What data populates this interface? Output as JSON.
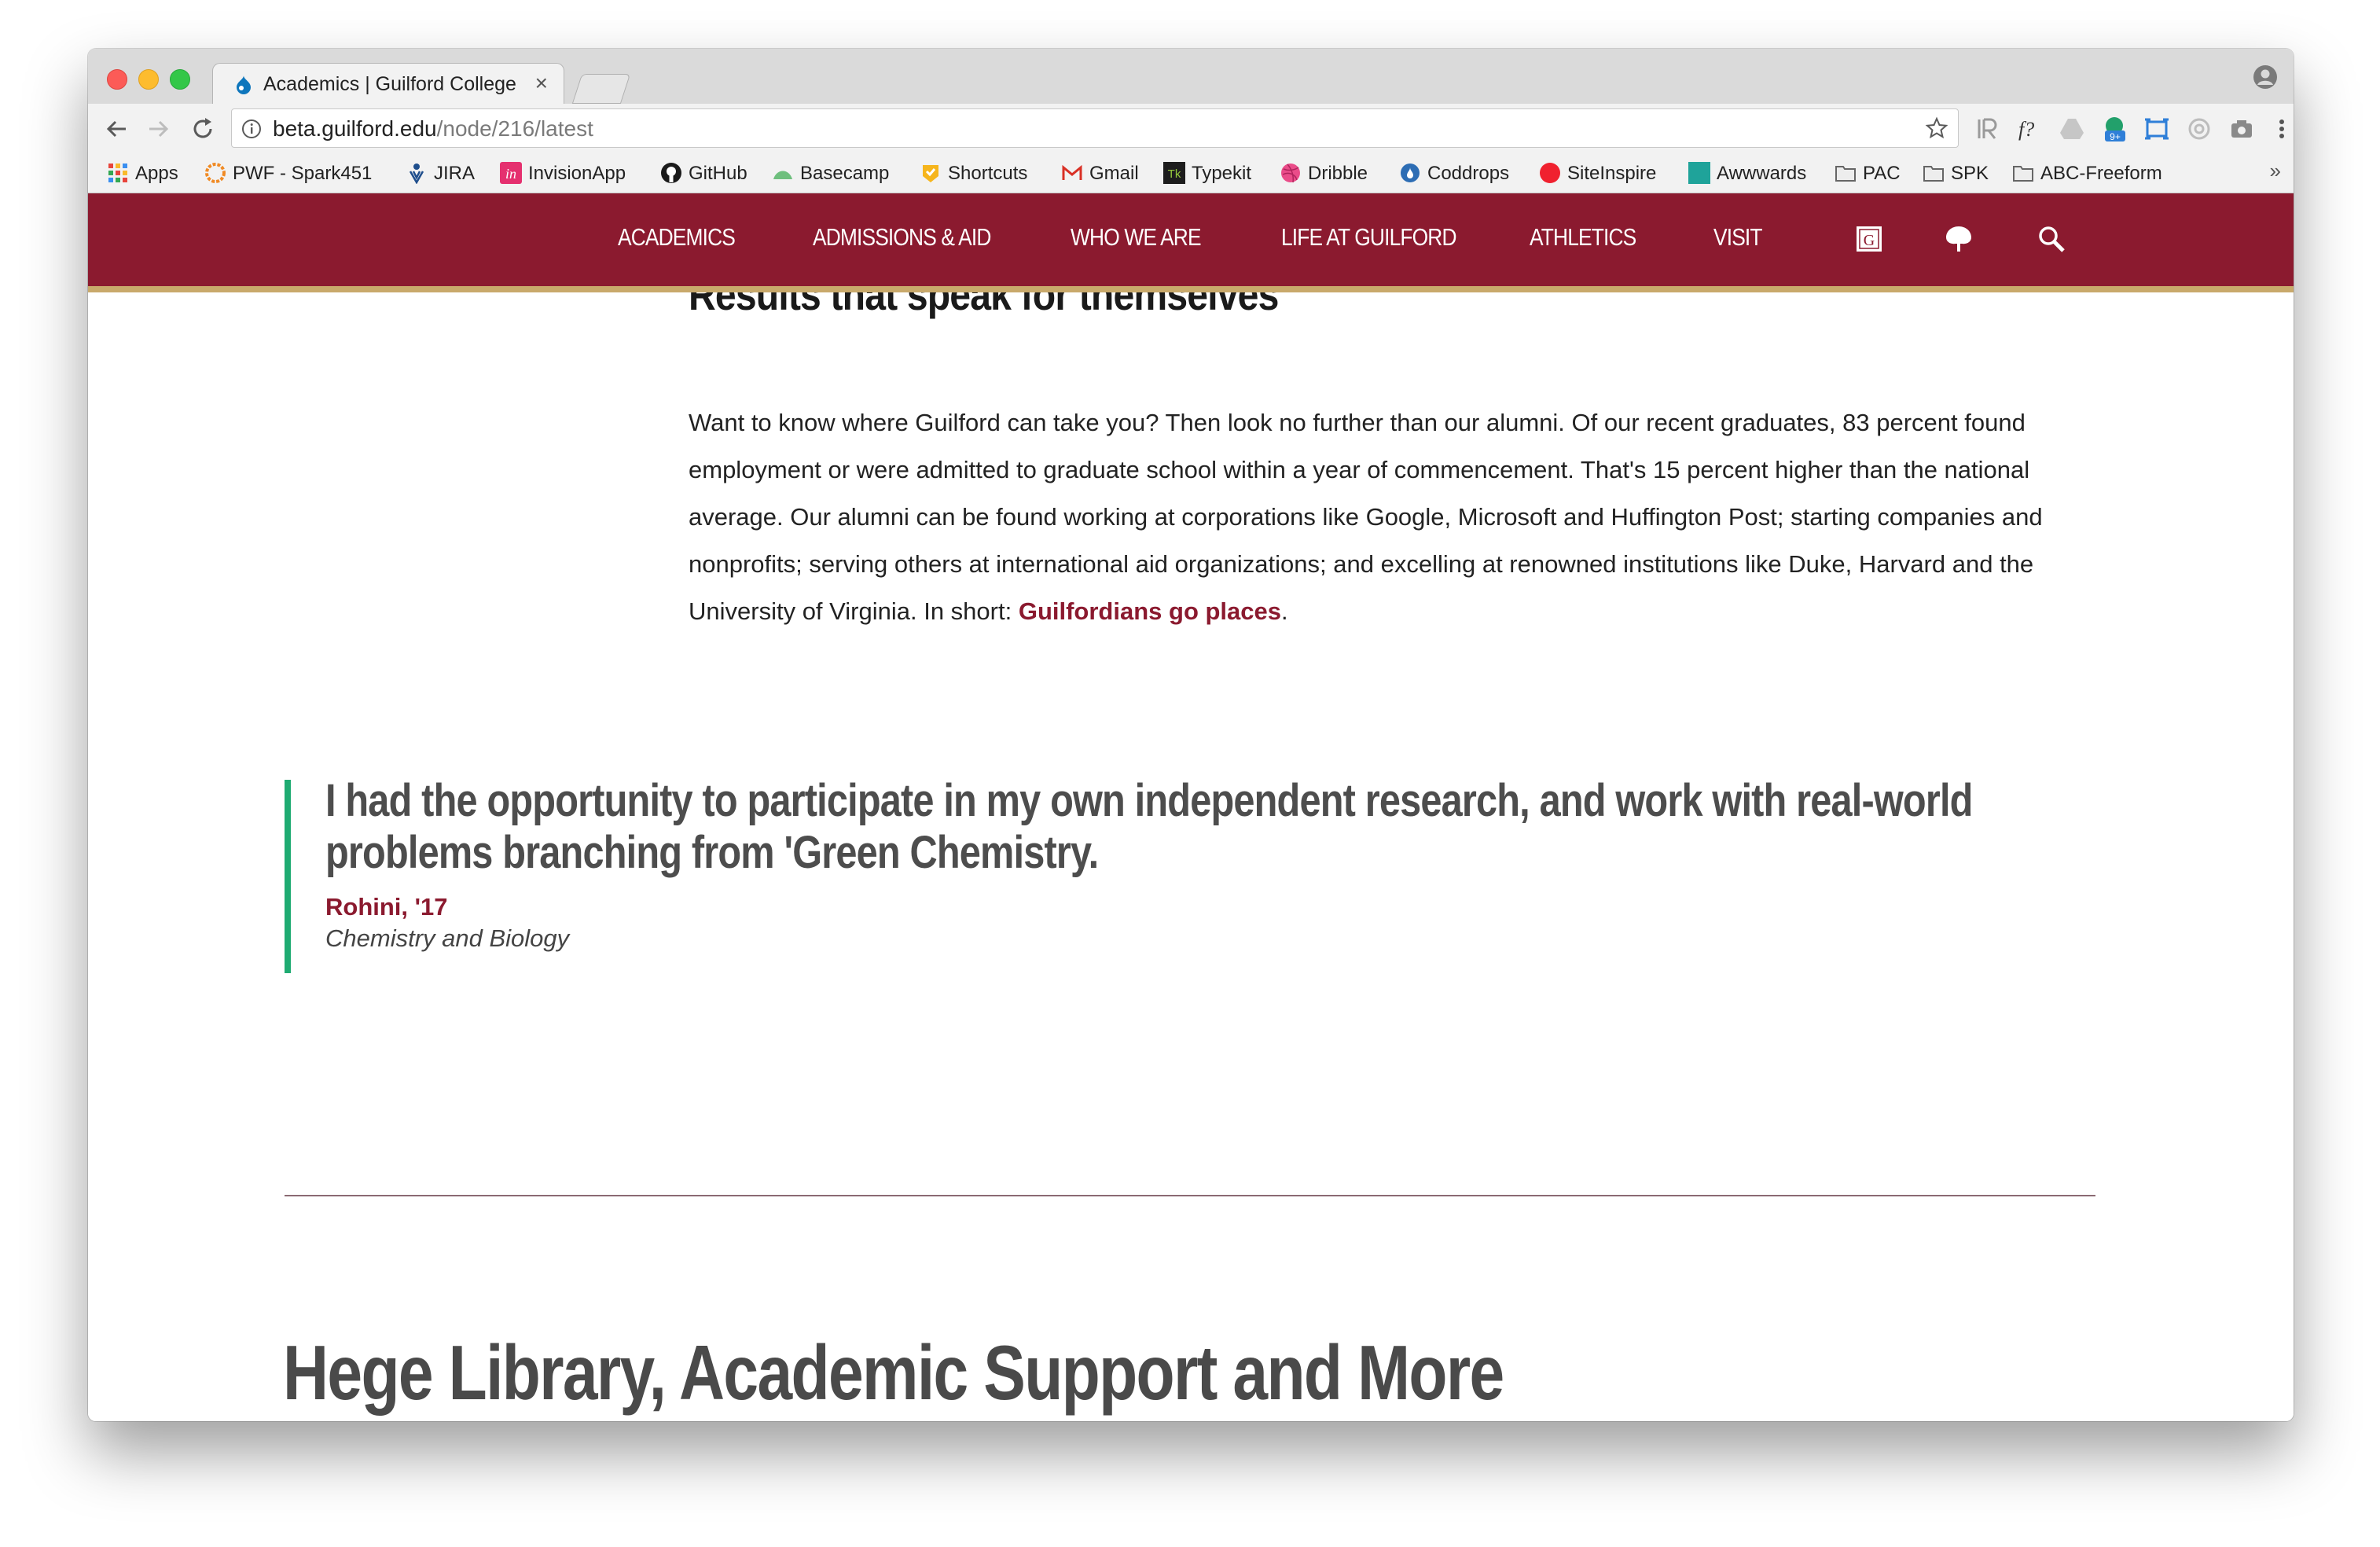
{
  "browser": {
    "tab": {
      "title": "Academics | Guilford College",
      "close": "×"
    },
    "address": {
      "host": "beta.guilford.edu",
      "path": "/node/216/latest"
    },
    "extensions": [
      "readability-icon",
      "font-identifier-icon",
      "google-drive-icon",
      "tab-counter-icon",
      "screenshot-icon",
      "ghostery-icon",
      "camera-icon",
      "color-picker-icon"
    ],
    "extension_badge": "9+",
    "bookmarks": [
      {
        "label": "Apps",
        "icon": "apps-grid-icon"
      },
      {
        "label": "PWF - Spark451",
        "icon": "spark451-icon"
      },
      {
        "label": "JIRA",
        "icon": "jira-icon"
      },
      {
        "label": "InvisionApp",
        "icon": "invision-icon"
      },
      {
        "label": "GitHub",
        "icon": "github-icon"
      },
      {
        "label": "Basecamp",
        "icon": "basecamp-icon"
      },
      {
        "label": "Shortcuts",
        "icon": "shortcuts-icon"
      },
      {
        "label": "Gmail",
        "icon": "gmail-icon"
      },
      {
        "label": "Typekit",
        "icon": "typekit-icon"
      },
      {
        "label": "Dribble",
        "icon": "dribbble-icon"
      },
      {
        "label": "Coddrops",
        "icon": "codrops-icon"
      },
      {
        "label": "SiteInspire",
        "icon": "siteinspire-icon"
      },
      {
        "label": "Awwwards",
        "icon": "awwwards-icon"
      },
      {
        "label": "PAC",
        "icon": "folder-icon"
      },
      {
        "label": "SPK",
        "icon": "folder-icon"
      },
      {
        "label": "ABC-Freeform",
        "icon": "folder-icon"
      }
    ],
    "bookmarks_overflow": "»"
  },
  "site": {
    "colors": {
      "maroon": "#8b1a2f",
      "gold": "#c9a96b",
      "quote_accent": "#1fab72"
    },
    "nav": [
      {
        "label": "ACADEMICS"
      },
      {
        "label": "ADMISSIONS & AID"
      },
      {
        "label": "WHO WE ARE"
      },
      {
        "label": "LIFE AT GUILFORD"
      },
      {
        "label": "ATHLETICS"
      },
      {
        "label": "VISIT"
      }
    ],
    "nav_icons": [
      "guilford-g-icon",
      "tree-icon",
      "search-icon"
    ]
  },
  "content": {
    "results_heading": "Results that speak for themselves",
    "results_body": "Want to know where Guilford can take you? Then look no further than our alumni. Of our recent graduates, 83 percent found employment or were admitted to graduate school within a year of commencement. That's 15 percent higher than the national average. Our alumni can be found working at corporations like Google, Microsoft and Huffington Post; starting companies and nonprofits; serving others at international aid organizations; and excelling at renowned institutions like Duke, Harvard and the University of Virginia. In short: ",
    "results_link": "Guilfordians go places",
    "results_end": ".",
    "quote": {
      "text": "I had the opportunity to participate in my own independent research, and work with real-world problems branching from 'Green Chemistry.",
      "author": "Rohini, '17",
      "role": "Chemistry and Biology"
    },
    "support_heading": "Hege Library, Academic Support and More"
  }
}
